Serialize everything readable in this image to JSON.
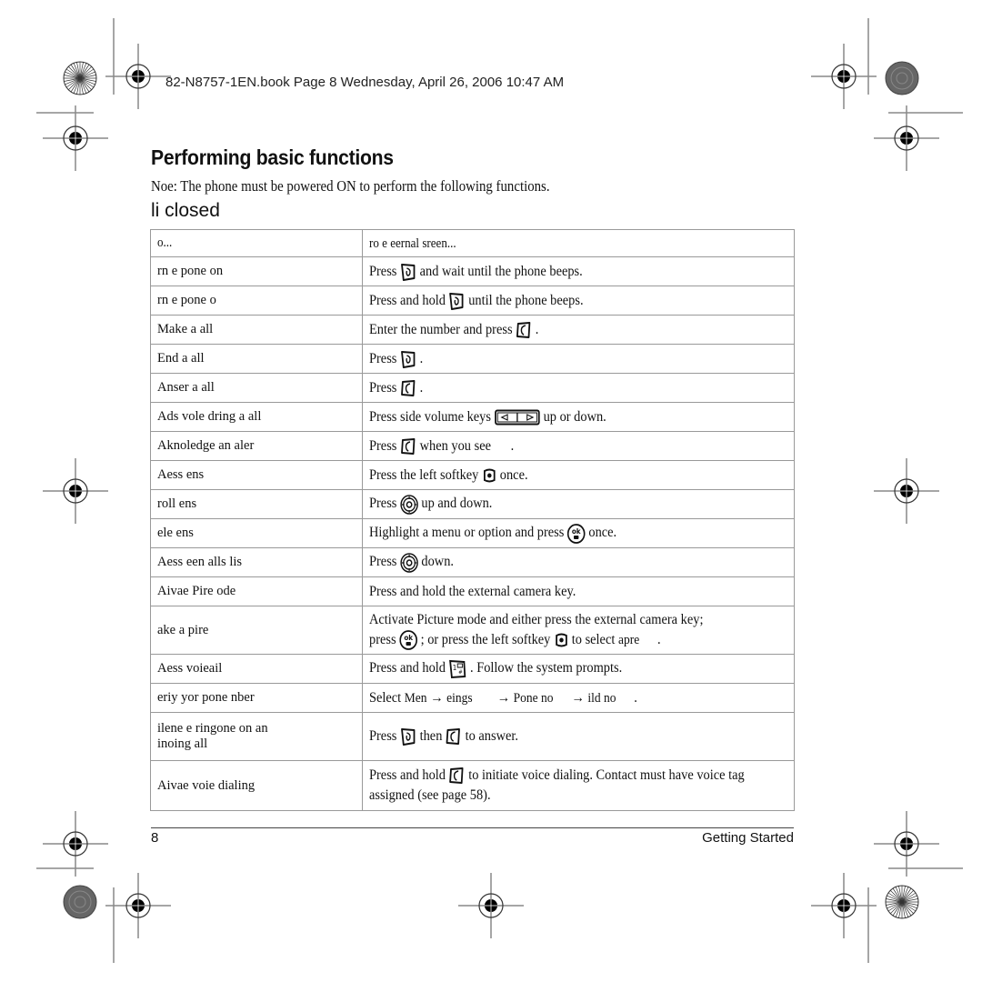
{
  "header": {
    "book_info": "82-N8757-1EN.book  Page 8  Wednesday, April 26, 2006  10:47 AM"
  },
  "page": {
    "title": "Performing basic functions",
    "note": "Noe:  The phone must be powered ON to perform the following functions.",
    "section_title": "li closed"
  },
  "table": {
    "header": {
      "task": "o...",
      "action": "ro e eernal sreen..."
    },
    "rows": [
      {
        "task": "rn e pone on",
        "action_parts": [
          "Press",
          "and wait until the phone beeps."
        ],
        "icons": [
          "end-power-key-icon"
        ]
      },
      {
        "task": "rn e pone o",
        "action_parts": [
          "Press and hold",
          "until the phone beeps."
        ],
        "icons": [
          "end-power-key-icon"
        ]
      },
      {
        "task": "Make a all",
        "action_parts": [
          "Enter the number and press",
          "."
        ],
        "icons": [
          "send-key-icon"
        ]
      },
      {
        "task": "End a all",
        "action_parts": [
          "Press",
          "."
        ],
        "icons": [
          "end-power-key-icon"
        ]
      },
      {
        "task": "Anser a all",
        "action_parts": [
          "Press",
          "."
        ],
        "icons": [
          "send-key-icon"
        ]
      },
      {
        "task": "Ads vole dring a all",
        "action_parts": [
          "Press side volume keys",
          "up or down."
        ],
        "icons": [
          "volume-keys-icon"
        ]
      },
      {
        "task": "Aknoledge an aler",
        "action_parts": [
          "Press",
          "when you see",
          "."
        ],
        "icons": [
          "send-key-icon"
        ]
      },
      {
        "task": "Aess ens",
        "action_parts": [
          "Press the left softkey",
          "once."
        ],
        "icons": [
          "left-softkey-icon"
        ]
      },
      {
        "task": "roll ens",
        "action_parts": [
          "Press",
          "up and down."
        ],
        "icons": [
          "navigation-key-icon"
        ]
      },
      {
        "task": "ele ens",
        "action_parts": [
          "Highlight a menu or option and press",
          "once."
        ],
        "icons": [
          "ok-key-icon"
        ]
      },
      {
        "task": "Aess een alls lis",
        "action_parts": [
          "Press",
          "down."
        ],
        "icons": [
          "navigation-key-icon"
        ]
      },
      {
        "task": "Aivae Pire ode",
        "action_parts": [
          "Press and hold the external camera key."
        ],
        "icons": []
      },
      {
        "task": "ake a pire",
        "action_line1": "Activate Picture mode and either press the external camera key;",
        "action_parts": [
          "press",
          "; or press the left softkey",
          "to select",
          "apre",
          "."
        ],
        "icons": [
          "ok-key-icon",
          "left-softkey-icon"
        ]
      },
      {
        "task": "Aess voieail",
        "action_parts": [
          "Press and hold",
          ". Follow the system prompts."
        ],
        "icons": [
          "voicemail-key-icon"
        ]
      },
      {
        "task": "eriy yor pone nber",
        "action_parts": [
          "Select",
          "Men",
          "→",
          "eings",
          "→",
          "Pone no",
          "→",
          "ild no",
          "."
        ],
        "icons": []
      },
      {
        "task_line1": "ilene e ringone on an",
        "task_line2": "inoing all",
        "action_parts": [
          "Press",
          "then",
          "to answer."
        ],
        "icons": [
          "end-power-key-icon",
          "send-key-icon"
        ]
      },
      {
        "task": "Aivae voie dialing",
        "action_parts": [
          "Press and hold",
          "to initiate voice dialing. Contact must have voice tag assigned (see page 58)."
        ],
        "icons": [
          "send-key-icon"
        ]
      }
    ]
  },
  "footer": {
    "page_number": "8",
    "section": "Getting Started"
  }
}
